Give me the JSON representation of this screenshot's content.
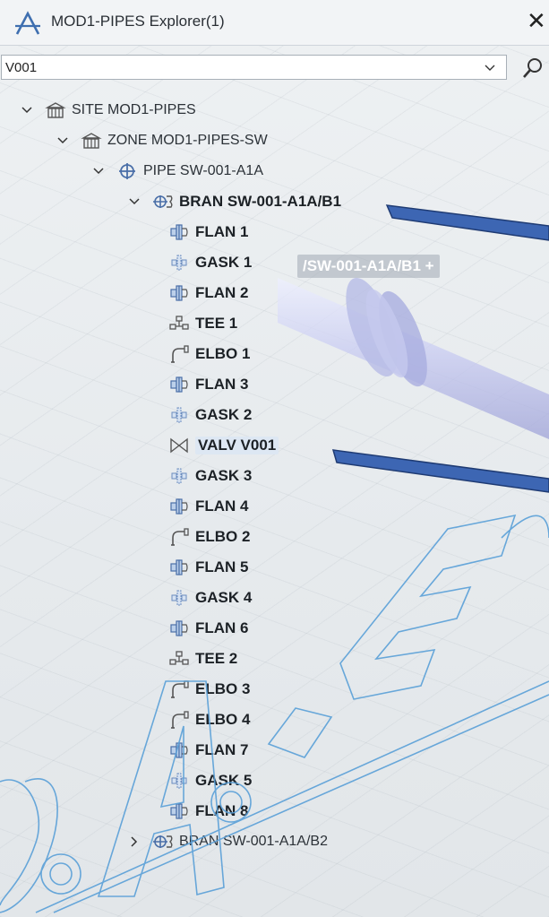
{
  "window": {
    "title": "MOD1-PIPES Explorer(1)",
    "close_symbol": "✕"
  },
  "search": {
    "value": "V001"
  },
  "tree": {
    "rows": [
      {
        "label": "SITE MOD1-PIPES",
        "icon": "site-icon",
        "expander": "expanded",
        "bold": false
      },
      {
        "label": "ZONE MOD1-PIPES-SW",
        "icon": "zone-icon",
        "expander": "expanded",
        "bold": false
      },
      {
        "label": "PIPE SW-001-A1A",
        "icon": "pipe-icon",
        "expander": "expanded",
        "bold": false
      },
      {
        "label": "BRAN SW-001-A1A/B1",
        "icon": "branch-icon",
        "expander": "expanded",
        "bold": true
      },
      {
        "label": "FLAN 1",
        "icon": "flange-icon",
        "bold": true
      },
      {
        "label": "GASK 1",
        "icon": "gasket-icon",
        "bold": true
      },
      {
        "label": "FLAN 2",
        "icon": "flange-icon",
        "bold": true
      },
      {
        "label": "TEE 1",
        "icon": "tee-icon",
        "bold": true
      },
      {
        "label": "ELBO 1",
        "icon": "elbow-icon",
        "bold": true
      },
      {
        "label": "FLAN 3",
        "icon": "flange-icon",
        "bold": true
      },
      {
        "label": "GASK 2",
        "icon": "gasket-icon",
        "bold": true
      },
      {
        "label": "VALV V001",
        "icon": "valve-icon",
        "bold": true,
        "selected": true
      },
      {
        "label": "GASK 3",
        "icon": "gasket-icon",
        "bold": true
      },
      {
        "label": "FLAN 4",
        "icon": "flange-icon",
        "bold": true
      },
      {
        "label": "ELBO 2",
        "icon": "elbow-icon",
        "bold": true
      },
      {
        "label": "FLAN 5",
        "icon": "flange-icon",
        "bold": true
      },
      {
        "label": "GASK 4",
        "icon": "gasket-icon",
        "bold": true
      },
      {
        "label": "FLAN 6",
        "icon": "flange-icon",
        "bold": true
      },
      {
        "label": "TEE 2",
        "icon": "tee-icon",
        "bold": true
      },
      {
        "label": "ELBO 3",
        "icon": "elbow-icon",
        "bold": true
      },
      {
        "label": "ELBO 4",
        "icon": "elbow-icon",
        "bold": true
      },
      {
        "label": "FLAN 7",
        "icon": "flange-icon",
        "bold": true
      },
      {
        "label": "GASK 5",
        "icon": "gasket-icon",
        "bold": true
      },
      {
        "label": "FLAN 8",
        "icon": "flange-icon",
        "bold": true
      },
      {
        "label": "BRAN SW-001-A1A/B2",
        "icon": "branch-icon",
        "expander": "collapsed",
        "bold": false
      }
    ]
  },
  "viewport": {
    "hover_label": "/SW-001-A1A/B1 +"
  },
  "watermark": {
    "text": "S.A.-E"
  },
  "colors": {
    "callout_blue": "#3d66b3",
    "selection_bg": "#dde7f3",
    "icon_blue": "#4a6fa8",
    "watermark_blue": "#5aa0d8"
  }
}
